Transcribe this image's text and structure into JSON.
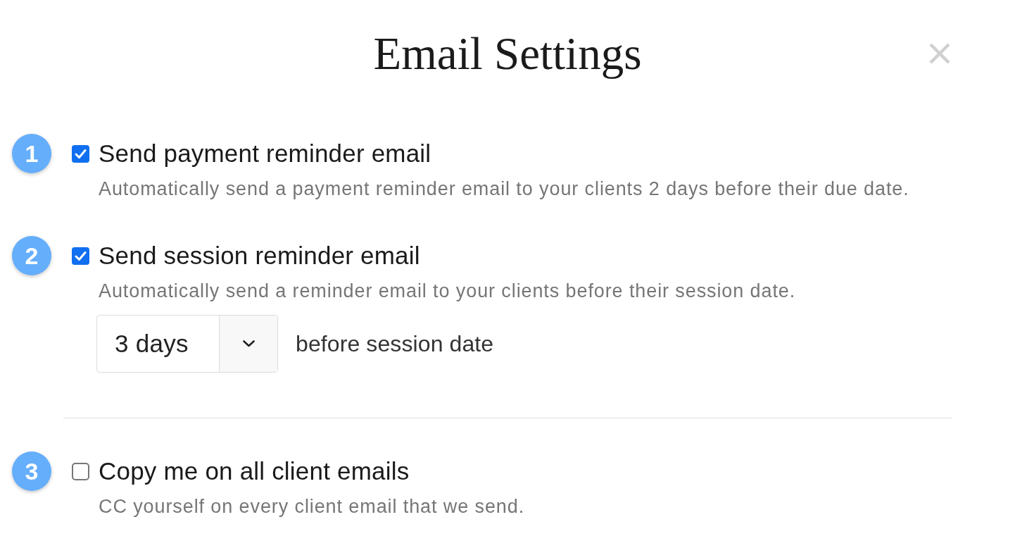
{
  "dialog": {
    "title": "Email Settings"
  },
  "groups": [
    {
      "settings": [
        {
          "number": "1",
          "label": "Send payment reminder email",
          "description": "Automatically send a payment reminder email to your clients 2 days before their due date.",
          "checked": true
        },
        {
          "number": "2",
          "label": "Send session reminder email",
          "description": "Automatically send a reminder email to your clients before their session date.",
          "checked": true,
          "timing": {
            "value": "3 days",
            "suffix": "before session date"
          }
        }
      ]
    },
    {
      "settings": [
        {
          "number": "3",
          "label": "Copy me on all client emails",
          "description": "CC yourself on every client email that we send.",
          "checked": false
        }
      ]
    }
  ]
}
